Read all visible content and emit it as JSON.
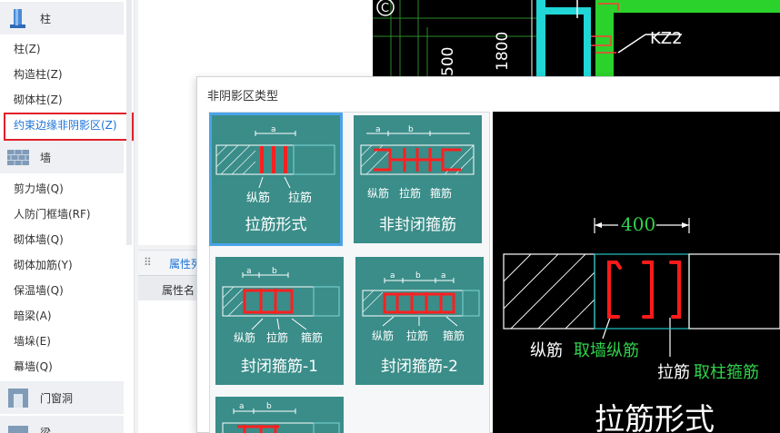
{
  "sidebar": {
    "cat_column": {
      "label": "柱",
      "icon": "column-icon"
    },
    "column_items": [
      {
        "label": "柱(Z)"
      },
      {
        "label": "构造柱(Z)"
      },
      {
        "label": "砌体柱(Z)"
      },
      {
        "label": "约束边缘非阴影区(Z)"
      }
    ],
    "cat_wall": {
      "label": "墙",
      "icon": "wall-icon"
    },
    "wall_items": [
      {
        "label": "剪力墙(Q)"
      },
      {
        "label": "人防门框墙(RF)"
      },
      {
        "label": "砌体墙(Q)"
      },
      {
        "label": "砌体加筋(Y)"
      },
      {
        "label": "保温墙(Q)"
      },
      {
        "label": "暗梁(A)"
      },
      {
        "label": "墙垛(E)"
      },
      {
        "label": "幕墙(Q)"
      }
    ],
    "cat_door": {
      "label": "门窗洞",
      "icon": "door-window-icon"
    },
    "cat_beam": {
      "label": "梁",
      "icon": "beam-icon"
    }
  },
  "properties": {
    "tab_label": "属性列",
    "col_header": "属性名"
  },
  "cad_bg": {
    "labels": [
      "KZ2",
      "1800",
      "500",
      "C"
    ]
  },
  "dialog": {
    "title": "非阴影区类型",
    "tiles": [
      {
        "name": "拉筋形式",
        "labels": [
          "a",
          "纵筋",
          "拉筋"
        ]
      },
      {
        "name": "非封闭箍筋",
        "labels": [
          "a",
          "b",
          "纵筋",
          "拉筋",
          "箍筋"
        ]
      },
      {
        "name": "封闭箍筋-1",
        "labels": [
          "a",
          "b",
          "纵筋",
          "拉筋",
          "箍筋"
        ]
      },
      {
        "name": "封闭箍筋-2",
        "labels": [
          "a",
          "b",
          "a",
          "纵筋",
          "拉筋",
          "箍筋"
        ]
      },
      {
        "name": "",
        "labels": [
          "a",
          "b"
        ]
      }
    ],
    "preview": {
      "dim_value": "400",
      "label_long": "纵筋",
      "label_long_note": "取墙纵筋",
      "label_tie": "拉筋",
      "label_tie_note": "取柱箍筋",
      "title": "拉筋形式"
    }
  },
  "colors": {
    "accent_blue": "#1a73d9",
    "highlight_red": "#e0202a",
    "tile_teal": "#3a8d89",
    "cad_green": "#2fd24a",
    "rebar_red": "#ff1a1a"
  }
}
